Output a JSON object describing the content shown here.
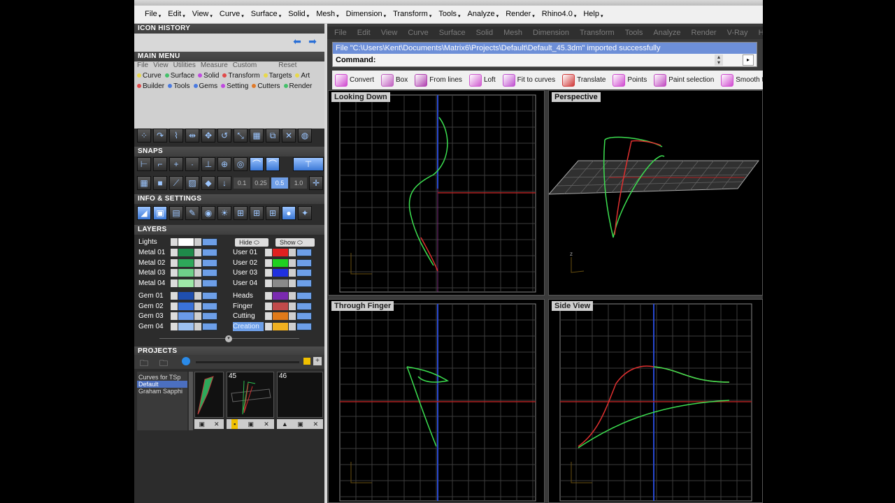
{
  "topmenu": [
    "File",
    "Edit",
    "View",
    "Curve",
    "Surface",
    "Solid",
    "Mesh",
    "Dimension",
    "Transform",
    "Tools",
    "Analyze",
    "Render",
    "Rhino4.0",
    "Help"
  ],
  "icon_history": {
    "title": "ICON HISTORY"
  },
  "main_menu": {
    "title": "MAIN MENU",
    "row1": [
      "File",
      "View",
      "Utilities",
      "Measure",
      "Custom",
      "Reset"
    ],
    "row2": [
      {
        "label": "Curve",
        "color": "#e8d84a"
      },
      {
        "label": "Surface",
        "color": "#44c06a"
      },
      {
        "label": "Solid",
        "color": "#c04ae0"
      },
      {
        "label": "Transform",
        "color": "#e04a4a"
      },
      {
        "label": "Targets",
        "color": "#e8d84a"
      },
      {
        "label": "Art",
        "color": "#e8d84a"
      }
    ],
    "row3": [
      {
        "label": "Builder",
        "color": "#e04a4a"
      },
      {
        "label": "Tools",
        "color": "#4a7ae0"
      },
      {
        "label": "Gems",
        "color": "#4a7ae0"
      },
      {
        "label": "Setting",
        "color": "#c04ae0"
      },
      {
        "label": "Cutters",
        "color": "#e07a2a"
      },
      {
        "label": "Render",
        "color": "#44c06a"
      }
    ]
  },
  "snaps": {
    "title": "SNAPS",
    "values": [
      "0.1",
      "0.25",
      "0.5",
      "1.0"
    ]
  },
  "info_settings": {
    "title": "INFO & SETTINGS"
  },
  "layers": {
    "title": "LAYERS",
    "lights": "Lights",
    "hide": "Hide",
    "show": "Show",
    "left": [
      {
        "name": "Metal 01",
        "color": "#1f8a4a"
      },
      {
        "name": "Metal 02",
        "color": "#2ea85a"
      },
      {
        "name": "Metal 03",
        "color": "#6fd08a"
      },
      {
        "name": "Metal 04",
        "color": "#9ee8a8"
      },
      {
        "name": "Gem 01",
        "color": "#1f4fb0"
      },
      {
        "name": "Gem 02",
        "color": "#3a72d8"
      },
      {
        "name": "Gem 03",
        "color": "#6a9ae8"
      },
      {
        "name": "Gem 04",
        "color": "#9dc0f0"
      }
    ],
    "right": [
      {
        "name": "User 01",
        "color": "#e02020"
      },
      {
        "name": "User 02",
        "color": "#20d020"
      },
      {
        "name": "User 03",
        "color": "#2030e0"
      },
      {
        "name": "User 04",
        "color": "#8a8a8a"
      },
      {
        "name": "Heads",
        "color": "#7a2ab0"
      },
      {
        "name": "Finger",
        "color": "#c04a4a"
      },
      {
        "name": "Cutting",
        "color": "#e07a1a"
      },
      {
        "name": "Creation",
        "color": "#f0b020"
      }
    ]
  },
  "projects": {
    "title": "PROJECTS",
    "list": [
      "Curves for TSp",
      "Default",
      "Graham Sapphi"
    ],
    "thumbs": [
      "",
      "45",
      "46"
    ]
  },
  "rhino_menu": [
    "File",
    "Edit",
    "View",
    "Curve",
    "Surface",
    "Solid",
    "Mesh",
    "Dimension",
    "Transform",
    "Tools",
    "Analyze",
    "Render",
    "V-Ray",
    "Help"
  ],
  "command": {
    "history": "File \"C:\\Users\\Kent\\Documents\\Matrix6\\Projects\\Default\\Default_45.3dm\" imported successfully",
    "prompt": "Command:"
  },
  "rhino_toolbar": [
    {
      "label": "Convert",
      "icon": "convert-icon",
      "color": "#d04ad0"
    },
    {
      "label": "Box",
      "icon": "box-icon",
      "color": "#c060c0"
    },
    {
      "label": "From lines",
      "icon": "from-lines-icon",
      "color": "#b040b0"
    },
    {
      "label": "Loft",
      "icon": "loft-icon",
      "color": "#d05ad0"
    },
    {
      "label": "Fit to curves",
      "icon": "fit-curves-icon",
      "color": "#c050d0"
    },
    {
      "label": "Translate",
      "icon": "translate-icon",
      "color": "#d03a3a"
    },
    {
      "label": "Points",
      "icon": "points-icon",
      "color": "#d04ad0"
    },
    {
      "label": "Paint selection",
      "icon": "paint-selection-icon",
      "color": "#c04ac0"
    },
    {
      "label": "Smooth to",
      "icon": "smooth-icon",
      "color": "#d04ad0"
    }
  ],
  "viewports": {
    "top_left": "Looking Down",
    "top_right": "Perspective",
    "bottom_left": "Through Finger",
    "bottom_right": "Side View"
  }
}
